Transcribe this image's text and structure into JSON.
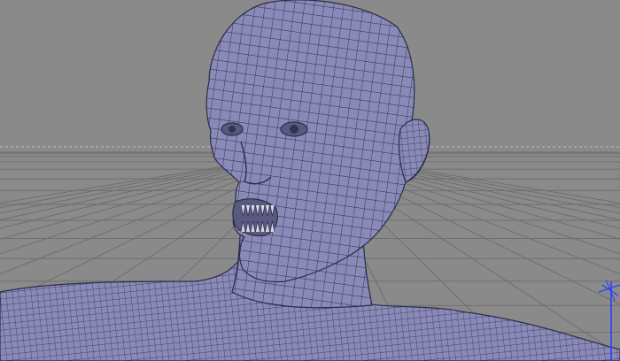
{
  "viewport": {
    "background_color": "#8a8a8a",
    "grid_color": "#6f6f6f",
    "horizon_color": "#a7b5c4",
    "mesh_fill_color": "#8a8ab8",
    "mesh_wire_color": "#2c2c4a",
    "manipulator_color": "#2a3eff",
    "objects": [
      {
        "name": "head-mesh",
        "display_mode": "wireframe-on-shaded"
      },
      {
        "name": "ground-grid",
        "display_mode": "grid"
      },
      {
        "name": "transform-manipulator",
        "display_mode": "gizmo"
      }
    ]
  }
}
